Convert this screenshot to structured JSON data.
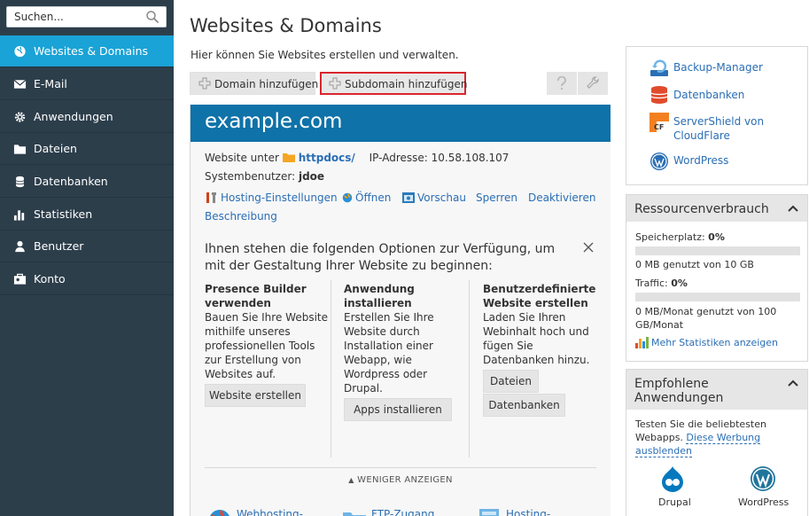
{
  "sidebar": {
    "search_placeholder": "Suchen...",
    "items": [
      {
        "label": "Websites & Domains"
      },
      {
        "label": "E-Mail"
      },
      {
        "label": "Anwendungen"
      },
      {
        "label": "Dateien"
      },
      {
        "label": "Datenbanken"
      },
      {
        "label": "Statistiken"
      },
      {
        "label": "Benutzer"
      },
      {
        "label": "Konto"
      }
    ]
  },
  "main": {
    "title": "Websites & Domains",
    "description": "Hier können Sie Websites erstellen und verwalten.",
    "toolbar": {
      "add_domain": "Domain hinzufügen",
      "add_subdomain": "Subdomain hinzufügen"
    },
    "domain": {
      "name": "example.com",
      "website_at_label": "Website unter",
      "docroot": "httpdocs/",
      "ip_label": "IP-Adresse:",
      "ip_value": "10.58.108.107",
      "sysuser_label": "Systembenutzer:",
      "sysuser_value": "jdoe",
      "actions": {
        "hosting_settings": "Hosting-Einstellungen",
        "open": "Öffnen",
        "preview": "Vorschau",
        "suspend": "Sperren",
        "deactivate": "Deaktivieren",
        "description": "Beschreibung"
      },
      "options_title": "Ihnen stehen die folgenden Optionen zur Verfügung, um mit der Gestaltung Ihrer Website zu beginnen:",
      "columns": [
        {
          "heading": "Presence Builder verwenden",
          "text": "Bauen Sie Ihre Website mithilfe unseres professionellen Tools zur Erstellung von Websites auf.",
          "buttons": [
            "Website erstellen"
          ]
        },
        {
          "heading": "Anwendung installieren",
          "text": "Erstellen Sie Ihre Website durch Installation einer Webapp, wie Wordpress oder Drupal.",
          "buttons": [
            "Apps installieren"
          ]
        },
        {
          "heading": "Benutzerdefinierte Website erstellen",
          "text": "Laden Sie Ihren Webinhalt hoch und fügen Sie Datenbanken hinzu.",
          "buttons": [
            "Dateien",
            "Datenbanken"
          ]
        }
      ],
      "show_less": "WENIGER ANZEIGEN",
      "bottom_links": {
        "webhosting_access": "Webhosting-Zugang",
        "ftp_access": "FTP-Zugang",
        "hosting_settings": "Hosting-Einstellungen"
      }
    }
  },
  "right": {
    "links": {
      "backup": "Backup-Manager",
      "databases": "Datenbanken",
      "servershield": "ServerShield von CloudFlare",
      "wordpress": "WordPress"
    },
    "resources": {
      "title": "Ressourcenverbrauch",
      "storage_label": "Speicherplatz:",
      "storage_pct": "0%",
      "storage_detail": "0 MB genutzt von 10 GB",
      "storage_fraction": 0,
      "traffic_label": "Traffic:",
      "traffic_pct": "0%",
      "traffic_detail": "0 MB/Monat genutzt von 100 GB/Monat",
      "traffic_fraction": 0,
      "more_stats": "Mehr Statistiken anzeigen"
    },
    "recommended": {
      "title": "Empfohlene Anwendungen",
      "intro": "Testen Sie die beliebtesten Webapps.",
      "hide_ad": "Diese Werbung ausblenden",
      "apps": [
        "Drupal",
        "WordPress"
      ]
    }
  },
  "colors": {
    "sidebar_bg": "#2d3e4b",
    "active_nav": "#1aa3d6",
    "domain_header": "#0f72a8",
    "link": "#2a6eb5",
    "highlight_border": "#d9262d"
  }
}
